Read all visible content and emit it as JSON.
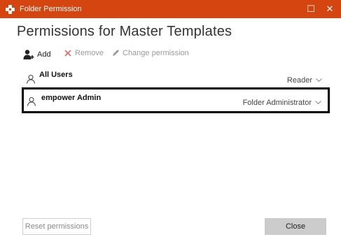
{
  "window": {
    "title": "Folder Permission",
    "maximize_glyph": "☐",
    "close_glyph": "✕",
    "accent_color": "#d5450f"
  },
  "heading": "Permissions for Master Templates",
  "toolbar": {
    "add_label": "Add",
    "remove_label": "Remove",
    "change_label": "Change permission"
  },
  "users": [
    {
      "name": "All Users",
      "role": "Reader"
    },
    {
      "name": "empower Admin",
      "role": "Folder Administrator"
    }
  ],
  "buttons": {
    "reset_label": "Reset permissions",
    "close_label": "Close"
  }
}
